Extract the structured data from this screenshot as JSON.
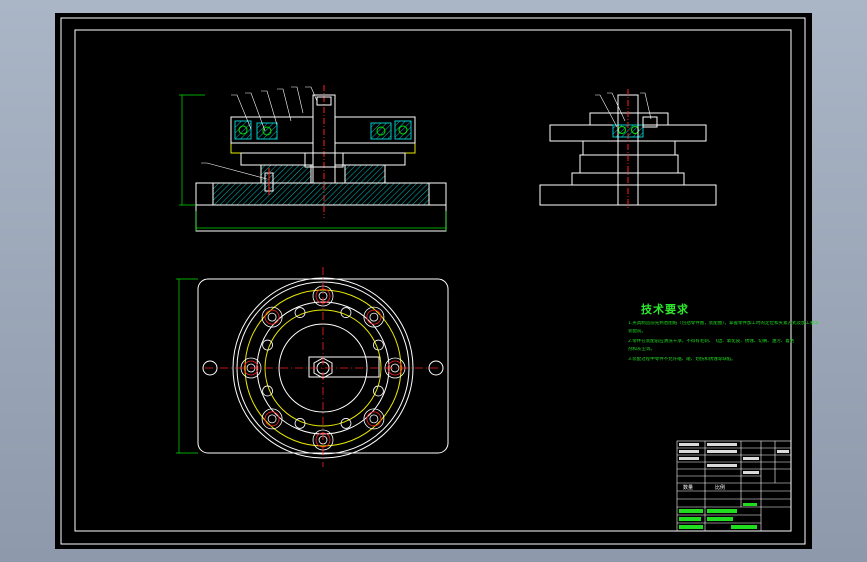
{
  "app": {
    "viewport_bg": "#000000",
    "outer_bg": "#9aa6b6"
  },
  "colors": {
    "line": "#ffffff",
    "hatch": "#00c8c8",
    "dimension": "#00e000",
    "centerline": "#ff2020",
    "part_yellow": "#e8e800",
    "note_green": "#20dd20"
  },
  "tech": {
    "title": "技术要求",
    "lines": [
      "1.夹具制造前先熟悉图纸（包括零件图，装配图），掌握零件加工时的定位和夹紧方式及加工要求",
      "装配前。",
      "2.零件在装配前应清洗干净，不得有毛刺、飞边、氧化皮、锈蚀、切屑、油污、着色",
      "剂和灰尘等。",
      "3.装配过程中零件不允许磕、碰、划伤和锈蚀等缺陷。"
    ]
  },
  "title_block": {
    "scale_label": "比例",
    "qty_label": "数量"
  }
}
